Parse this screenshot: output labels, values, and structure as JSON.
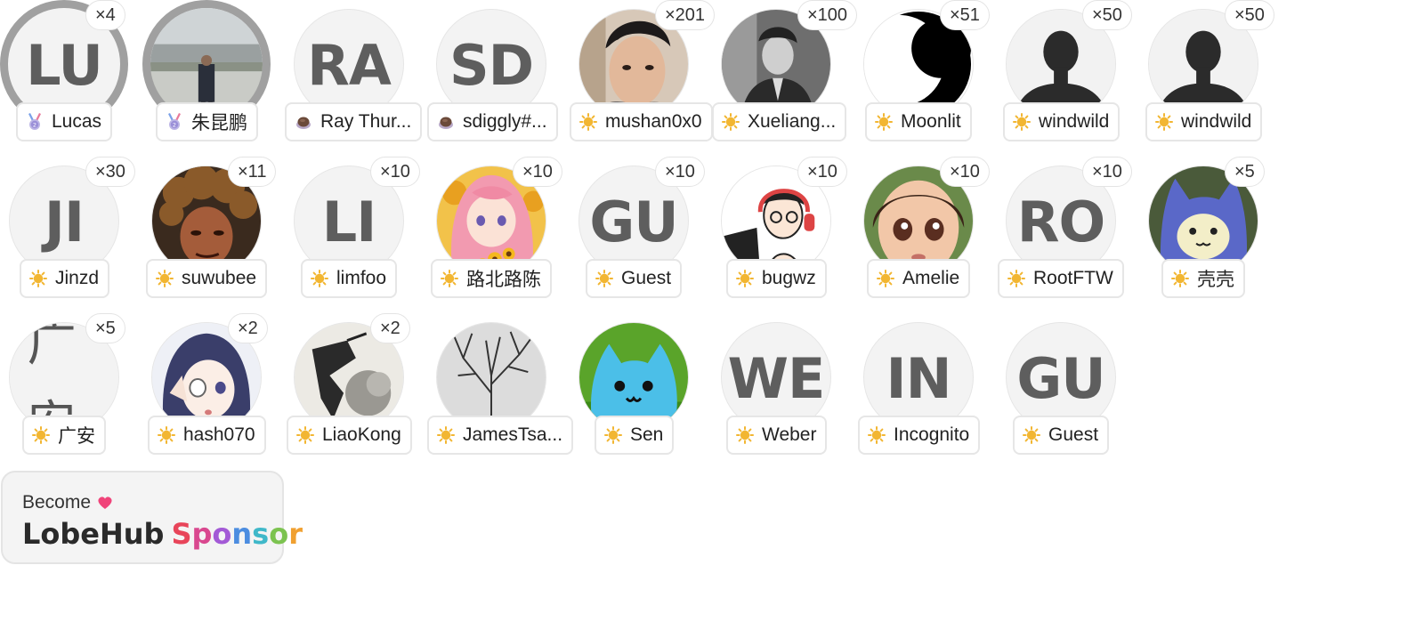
{
  "sponsors": [
    {
      "initials": "LU",
      "name": "Lucas",
      "count": "×4",
      "tier": "medal",
      "avatar": "initials"
    },
    {
      "initials": "",
      "name": "朱昆鹏",
      "count": "",
      "tier": "medal",
      "avatar": "photo-campus"
    },
    {
      "initials": "RA",
      "name": "Ray Thur...",
      "count": "",
      "tier": "coffee",
      "avatar": "initials"
    },
    {
      "initials": "SD",
      "name": "sdiggly#...",
      "count": "",
      "tier": "coffee",
      "avatar": "initials"
    },
    {
      "initials": "",
      "name": "mushan0x0",
      "count": "×201",
      "tier": "sun",
      "avatar": "photo-face"
    },
    {
      "initials": "",
      "name": "Xueliang...",
      "count": "×100",
      "tier": "sun",
      "avatar": "photo-bw"
    },
    {
      "initials": "",
      "name": "Moonlit",
      "count": "×51",
      "tier": "sun",
      "avatar": "moon"
    },
    {
      "initials": "",
      "name": "windwild",
      "count": "×50",
      "tier": "sun",
      "avatar": "silhouette"
    },
    {
      "initials": "",
      "name": "windwild",
      "count": "×50",
      "tier": "sun",
      "avatar": "silhouette"
    },
    {
      "initials": "JI",
      "name": "Jinzd",
      "count": "×30",
      "tier": "sun",
      "avatar": "initials"
    },
    {
      "initials": "",
      "name": "suwubee",
      "count": "×11",
      "tier": "sun",
      "avatar": "photo-curly"
    },
    {
      "initials": "LI",
      "name": "limfoo",
      "count": "×10",
      "tier": "sun",
      "avatar": "initials"
    },
    {
      "initials": "",
      "name": "路北路陈",
      "count": "×10",
      "tier": "sun",
      "avatar": "anime-pink"
    },
    {
      "initials": "GU",
      "name": "Guest",
      "count": "×10",
      "tier": "sun",
      "avatar": "initials"
    },
    {
      "initials": "",
      "name": "bugwz",
      "count": "×10",
      "tier": "sun",
      "avatar": "cartoon-headphones"
    },
    {
      "initials": "",
      "name": "Amelie",
      "count": "×10",
      "tier": "sun",
      "avatar": "doll"
    },
    {
      "initials": "RO",
      "name": "RootFTW",
      "count": "×10",
      "tier": "sun",
      "avatar": "initials"
    },
    {
      "initials": "",
      "name": "壳壳",
      "count": "×5",
      "tier": "sun",
      "avatar": "blue-cat"
    },
    {
      "initials": "",
      "name": "广安",
      "count": "×5",
      "tier": "sun",
      "avatar": "chinese-char"
    },
    {
      "initials": "",
      "name": "hash070",
      "count": "×2",
      "tier": "sun",
      "avatar": "anime-girl"
    },
    {
      "initials": "",
      "name": "LiaoKong",
      "count": "×2",
      "tier": "sun",
      "avatar": "ink"
    },
    {
      "initials": "",
      "name": "JamesTsa...",
      "count": "",
      "tier": "sun",
      "avatar": "tree"
    },
    {
      "initials": "",
      "name": "Sen",
      "count": "",
      "tier": "sun",
      "avatar": "plush-cat"
    },
    {
      "initials": "WE",
      "name": "Weber",
      "count": "",
      "tier": "sun",
      "avatar": "initials"
    },
    {
      "initials": "IN",
      "name": "Incognito",
      "count": "",
      "tier": "sun",
      "avatar": "initials"
    },
    {
      "initials": "GU",
      "name": "Guest",
      "count": "",
      "tier": "sun",
      "avatar": "initials"
    }
  ],
  "sponsor_card": {
    "become": "Become",
    "brand": "LobeHub",
    "sponsor_word": "Sponsor"
  },
  "colors": {
    "tier_sun": "#f2b632",
    "tier_coffee": "#6b4a3a",
    "tier_medal": "#9a8fd8",
    "heart": "#f0447a"
  }
}
